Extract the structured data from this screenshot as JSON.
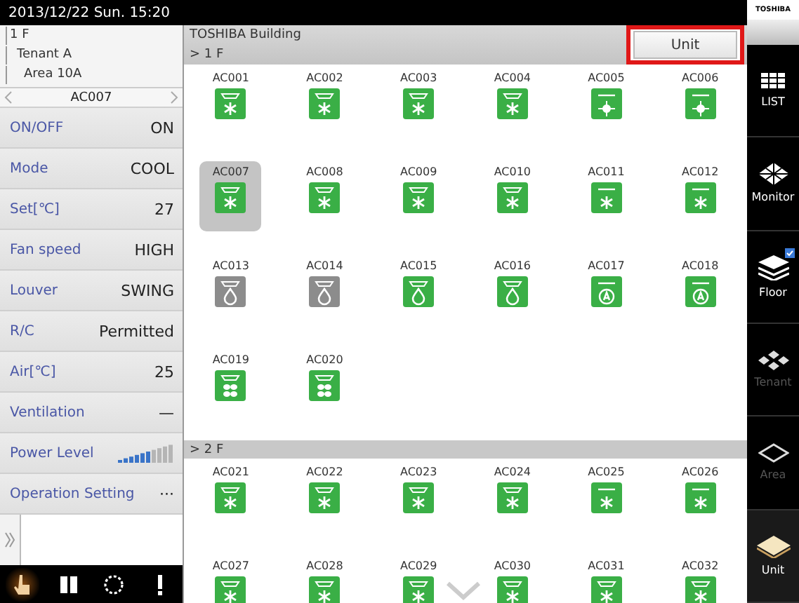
{
  "status_bar": {
    "datetime": "2013/12/22 Sun. 15:20"
  },
  "tree": [
    {
      "label": "1 F",
      "children": [
        {
          "label": "Tenant A",
          "children": [
            {
              "label": "Area 10A"
            }
          ]
        }
      ]
    }
  ],
  "selected_unit": "AC007",
  "properties": [
    {
      "kind": "value",
      "label": "ON/OFF",
      "value": "ON"
    },
    {
      "kind": "value",
      "label": "Mode",
      "value": "COOL"
    },
    {
      "kind": "value",
      "label": "Set[℃]",
      "value": "27"
    },
    {
      "kind": "value",
      "label": "Fan speed",
      "value": "HIGH"
    },
    {
      "kind": "value",
      "label": "Louver",
      "value": "SWING"
    },
    {
      "kind": "value",
      "label": "R/C",
      "value": "Permitted"
    },
    {
      "kind": "value",
      "label": "Air[℃]",
      "value": "25"
    },
    {
      "kind": "value",
      "label": "Ventilation",
      "value": "—"
    },
    {
      "kind": "meter",
      "label": "Power Level",
      "level": 0.6
    },
    {
      "kind": "value",
      "label": "Operation Setting",
      "value": "···"
    }
  ],
  "toolbar": [
    {
      "kind": "hand",
      "selected": true
    },
    {
      "kind": "pause",
      "selected": false
    },
    {
      "kind": "ring",
      "selected": false
    },
    {
      "kind": "alert",
      "selected": false
    }
  ],
  "header": {
    "building": "TOSHIBA Building",
    "view_button": "Unit"
  },
  "floors": [
    {
      "label": "> 1 F",
      "units": [
        {
          "name": "AC001",
          "kind": "cassette-cool",
          "on": true,
          "selected": false
        },
        {
          "name": "AC002",
          "kind": "cassette-cool",
          "on": true,
          "selected": false
        },
        {
          "name": "AC003",
          "kind": "cassette-cool",
          "on": true,
          "selected": false
        },
        {
          "name": "AC004",
          "kind": "cassette-cool",
          "on": true,
          "selected": false
        },
        {
          "name": "AC005",
          "kind": "flat-heat",
          "on": true,
          "selected": false
        },
        {
          "name": "AC006",
          "kind": "flat-heat",
          "on": true,
          "selected": false
        },
        {
          "name": "AC007",
          "kind": "cassette-cool",
          "on": true,
          "selected": true
        },
        {
          "name": "AC008",
          "kind": "cassette-cool",
          "on": true,
          "selected": false
        },
        {
          "name": "AC009",
          "kind": "cassette-cool",
          "on": true,
          "selected": false
        },
        {
          "name": "AC010",
          "kind": "cassette-cool",
          "on": true,
          "selected": false
        },
        {
          "name": "AC011",
          "kind": "flat-cool",
          "on": true,
          "selected": false
        },
        {
          "name": "AC012",
          "kind": "flat-cool",
          "on": true,
          "selected": false
        },
        {
          "name": "AC013",
          "kind": "cassette-dry",
          "on": false,
          "selected": false
        },
        {
          "name": "AC014",
          "kind": "cassette-dry",
          "on": false,
          "selected": false
        },
        {
          "name": "AC015",
          "kind": "cassette-dry",
          "on": true,
          "selected": false
        },
        {
          "name": "AC016",
          "kind": "cassette-dry",
          "on": true,
          "selected": false
        },
        {
          "name": "AC017",
          "kind": "flat-auto",
          "on": true,
          "selected": false
        },
        {
          "name": "AC018",
          "kind": "flat-auto",
          "on": true,
          "selected": false
        },
        {
          "name": "AC019",
          "kind": "cassette-fan",
          "on": true,
          "selected": false
        },
        {
          "name": "AC020",
          "kind": "cassette-fan",
          "on": true,
          "selected": false
        }
      ]
    },
    {
      "label": "> 2 F",
      "units": [
        {
          "name": "AC021",
          "kind": "cassette-cool",
          "on": true,
          "selected": false
        },
        {
          "name": "AC022",
          "kind": "cassette-cool",
          "on": true,
          "selected": false
        },
        {
          "name": "AC023",
          "kind": "cassette-cool",
          "on": true,
          "selected": false
        },
        {
          "name": "AC024",
          "kind": "cassette-cool",
          "on": true,
          "selected": false
        },
        {
          "name": "AC025",
          "kind": "flat-cool",
          "on": true,
          "selected": false
        },
        {
          "name": "AC026",
          "kind": "flat-cool",
          "on": true,
          "selected": false
        },
        {
          "name": "AC027",
          "kind": "cassette-cool",
          "on": true,
          "selected": false
        },
        {
          "name": "AC028",
          "kind": "cassette-cool",
          "on": true,
          "selected": false
        },
        {
          "name": "AC029",
          "kind": "cassette-cool",
          "on": true,
          "selected": false
        },
        {
          "name": "AC030",
          "kind": "cassette-cool",
          "on": true,
          "selected": false
        },
        {
          "name": "AC031",
          "kind": "cassette-cool",
          "on": true,
          "selected": false
        },
        {
          "name": "AC032",
          "kind": "cassette-cool",
          "on": true,
          "selected": false
        }
      ]
    }
  ],
  "brand": "TOSHIBA",
  "nav": [
    {
      "label": "LIST",
      "kind": "grid",
      "enabled": true,
      "selected": false,
      "badge": false
    },
    {
      "label": "Monitor",
      "kind": "lattice",
      "enabled": true,
      "selected": false,
      "badge": false
    },
    {
      "label": "Floor",
      "kind": "layers",
      "enabled": true,
      "selected": false,
      "badge": true
    },
    {
      "label": "Tenant",
      "kind": "diamonds",
      "enabled": false,
      "selected": false,
      "badge": false
    },
    {
      "label": "Area",
      "kind": "outline",
      "enabled": false,
      "selected": false,
      "badge": false
    },
    {
      "label": "Unit",
      "kind": "solid",
      "enabled": true,
      "selected": true,
      "badge": false
    }
  ]
}
